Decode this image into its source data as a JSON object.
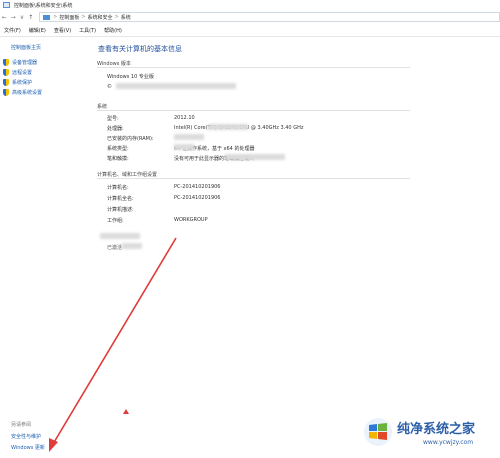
{
  "window": {
    "title": "控制面板\\系统和安全\\系统"
  },
  "address": {
    "back": "←",
    "forward": "→",
    "recent": "∨",
    "up": "↑",
    "crumbs": [
      "控制面板",
      "系统和安全",
      "系统"
    ],
    "separator": ">"
  },
  "menu": {
    "items": [
      "文件(F)",
      "编辑(E)",
      "查看(V)",
      "工具(T)",
      "帮助(H)"
    ]
  },
  "sidebar": {
    "home": "控制面板主页",
    "links": [
      "设备管理器",
      "远程设置",
      "系统保护",
      "高级系统设置"
    ],
    "see_also": "另请参阅",
    "bottom_links": [
      "安全性与维护",
      "Windows 更新"
    ]
  },
  "main": {
    "title": "查看有关计算机的基本信息",
    "windows_edition": {
      "header": "Windows 版本",
      "edition": "Windows 10 专业版",
      "copyright_start": "©"
    },
    "system": {
      "header": "系统",
      "rows": [
        {
          "label": "型号:",
          "value": "2012.10"
        },
        {
          "label": "处理器:",
          "value": "Intel(R) Core(TM) i3-3240 CPU @ 3.40GHz   3.40 GHz"
        },
        {
          "label": "已安装的内存(RAM):",
          "value": ""
        },
        {
          "label": "系统类型:",
          "value": "64 位操作系统，基于 x64 的处理器"
        },
        {
          "label": "笔和触摸:",
          "value": "没有可用于此显示器的笔或触控输入"
        }
      ]
    },
    "computer": {
      "header": "计算机名、域和工作组设置",
      "rows": [
        {
          "label": "计算机名:",
          "value": "PC-201410201906"
        },
        {
          "label": "计算机全名:",
          "value": "PC-201410201906"
        },
        {
          "label": "计算机描述:",
          "value": ""
        },
        {
          "label": "工作组:",
          "value": "WORKGROUP"
        }
      ]
    },
    "activation": {
      "fragment": "已激活"
    }
  },
  "watermark": {
    "name": "纯净系统之家",
    "url": "www.ycwjzy.com"
  },
  "colors": {
    "link": "#1a5fb4",
    "title": "#1f4e9c",
    "arrow": "#e03a3a",
    "watermark": "#2c5fa8"
  }
}
